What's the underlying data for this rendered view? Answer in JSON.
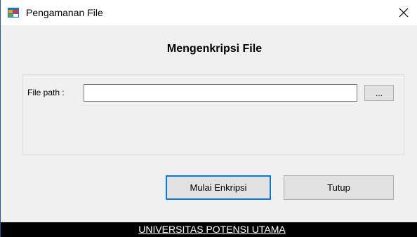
{
  "window": {
    "title": "Pengamanan File",
    "icon": "windows-form-icon",
    "close_icon": "close-icon"
  },
  "main": {
    "heading": "Mengenkripsi File",
    "file_path_label": "File path :",
    "file_path_value": "",
    "browse_label": "..."
  },
  "actions": {
    "start_label": "Mulai Enkripsi",
    "close_label": "Tutup"
  },
  "footer": {
    "text": "UNIVERSITAS POTENSI UTAMA"
  },
  "colors": {
    "accent": "#0078d7",
    "window_bg": "#f0f0f0",
    "footer_bg": "#000000"
  }
}
